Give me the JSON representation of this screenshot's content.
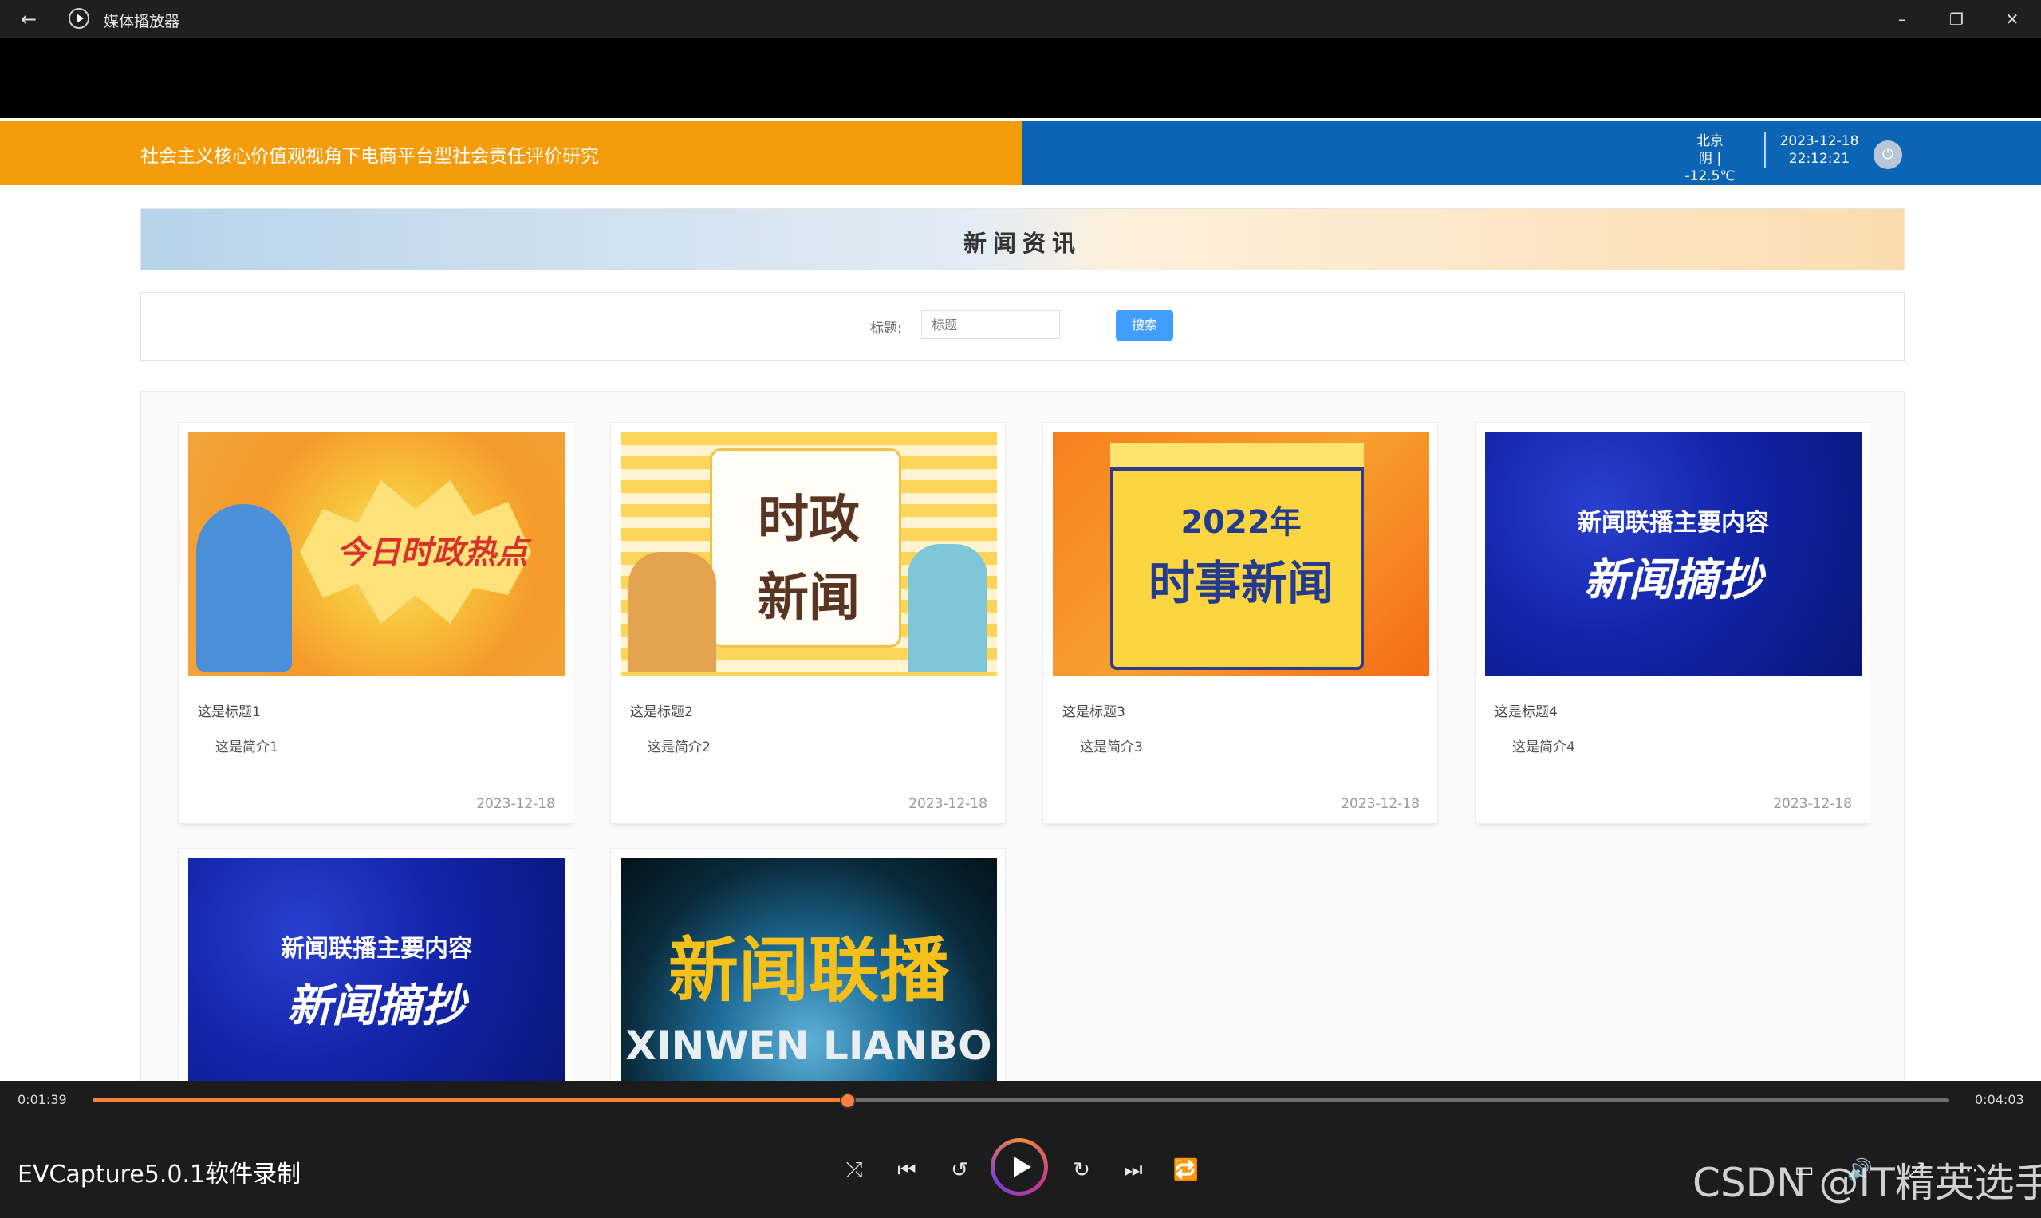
{
  "window": {
    "title": "媒体播放器",
    "back_icon": "←",
    "minimize": "–",
    "restore": "❐",
    "close": "✕"
  },
  "header": {
    "site_title": "社会主义核心价值观视角下电商平台型社会责任评价研究",
    "city": "北京",
    "weather": "阴 | -12.5℃",
    "date": "2023-12-18",
    "time": "22:12:21",
    "colors": {
      "left": "#f59c0c",
      "right": "#0b64b4"
    }
  },
  "section": {
    "title": "新闻资讯"
  },
  "search": {
    "label": "标题:",
    "placeholder": "标题",
    "button": "搜索"
  },
  "news": [
    {
      "title": "这是标题1",
      "desc": "这是简介1",
      "date": "2023-12-18",
      "image_text": "今日时政热点"
    },
    {
      "title": "这是标题2",
      "desc": "这是简介2",
      "date": "2023-12-18",
      "image_text_1": "时政",
      "image_text_2": "新闻"
    },
    {
      "title": "这是标题3",
      "desc": "这是简介3",
      "date": "2023-12-18",
      "image_text_1": "2022年",
      "image_text_2": "时事新闻"
    },
    {
      "title": "这是标题4",
      "desc": "这是简介4",
      "date": "2023-12-18",
      "image_text_1": "新闻联播主要内容",
      "image_text_2": "新闻摘抄"
    },
    {
      "image_text_1": "新闻联播主要内容",
      "image_text_2": "新闻摘抄"
    },
    {
      "image_text_1": "新闻联播",
      "image_text_2": "XINWEN LIANBO"
    }
  ],
  "player": {
    "current_time": "0:01:39",
    "total_time": "0:04:03",
    "progress": 0.407,
    "video_title": "EVCapture5.0.1软件录制",
    "accent": "#f7813d",
    "icons": {
      "shuffle": "⤮",
      "prev": "⏮",
      "rewind": "↺",
      "forward": "↻",
      "next": "⏭",
      "repeat": "🔁",
      "subtitles": "▭",
      "volume": "🔊",
      "fullscreen": "⤢",
      "more": "⋯"
    }
  },
  "watermark": "CSDN @IT精英选手"
}
